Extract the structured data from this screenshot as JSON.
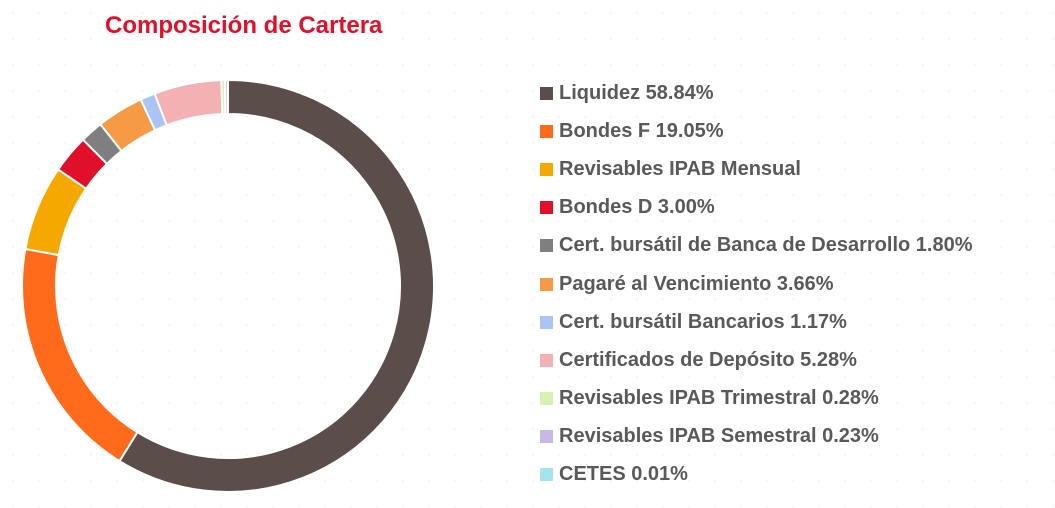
{
  "chart_data": {
    "type": "pie",
    "title": "Composición de Cartera",
    "categories": [
      "Liquidez",
      "Bondes F",
      "Revisables IPAB Mensual",
      "Bondes D",
      "Cert. bursátil de Banca de Desarrollo",
      "Pagaré al Vencimiento",
      "Cert. bursátil Bancarios",
      "Certificados de Depósito",
      "Revisables IPAB Trimestral",
      "Revisables IPAB Semestral",
      "CETES"
    ],
    "values": [
      58.84,
      19.05,
      6.7,
      3.0,
      1.8,
      3.66,
      1.17,
      5.28,
      0.28,
      0.23,
      0.01
    ],
    "colors": [
      "#5b4d49",
      "#ff6b1a",
      "#f5a800",
      "#e0102a",
      "#7f7f7f",
      "#f79a46",
      "#a9c4f5",
      "#f4b1b3",
      "#d8f2b3",
      "#c9b8e6",
      "#a5e4ec"
    ],
    "legend": [
      "Liquidez 58.84%",
      "Bondes F 19.05%",
      "Revisables IPAB Mensual",
      "Bondes D 3.00%",
      "Cert. bursátil de Banca de Desarrollo 1.80%",
      "Pagaré al Vencimiento 3.66%",
      "Cert. bursátil Bancarios 1.17%",
      "Certificados de Depósito 5.28%",
      "Revisables IPAB Trimestral 0.28%",
      "Revisables IPAB Semestral 0.23%",
      "CETES 0.01%"
    ],
    "legend_position": "right",
    "donut": true
  }
}
